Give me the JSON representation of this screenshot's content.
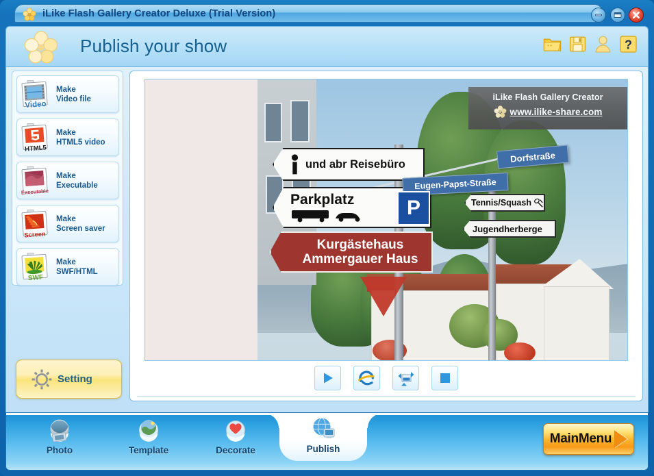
{
  "window": {
    "title": "iLike Flash Gallery Creator Deluxe (Trial Version)",
    "logo_icon": "clover-flower-icon",
    "controls": {
      "minimize": "minimize-button",
      "maximize": "maximize-button",
      "close": "close-button"
    }
  },
  "header": {
    "title": "Publish your show",
    "logo_icon": "clover-flower-icon",
    "icons": [
      {
        "name": "open-folder-icon",
        "glyph": "folder"
      },
      {
        "name": "save-icon",
        "glyph": "floppy"
      },
      {
        "name": "user-account-icon",
        "glyph": "person"
      },
      {
        "name": "help-icon",
        "glyph": "?"
      }
    ]
  },
  "sidebar": {
    "items": [
      {
        "icon": "video-file-icon",
        "badge": "Video",
        "line1": "Make",
        "line2": "Video file"
      },
      {
        "icon": "html5-video-icon",
        "badge": "HTML5",
        "line1": "Make",
        "line2": "HTML5 video"
      },
      {
        "icon": "executable-icon",
        "badge": "Executable",
        "line1": "Make",
        "line2": "Executable"
      },
      {
        "icon": "screen-saver-icon",
        "badge": "Screen",
        "line1": "Make",
        "line2": "Screen saver"
      },
      {
        "icon": "swf-html-icon",
        "badge": "SWF",
        "line1": "Make",
        "line2": "SWF/HTML"
      }
    ],
    "setting": {
      "label": "Setting",
      "icon": "gear-icon"
    }
  },
  "preview": {
    "watermark": {
      "line1": "iLike Flash Gallery Creator",
      "url": "www.ilike-share.com",
      "logo_icon": "clover-flower-icon"
    },
    "photo": {
      "description": "German street signpost with direction signs",
      "signs": [
        {
          "text": "und abr Reisebüro",
          "style": "white",
          "icon": "information-i-icon"
        },
        {
          "text": "Parkplatz",
          "style": "white",
          "plate": "P",
          "icon": "bus-and-car-icon"
        },
        {
          "text": "Kurgästehaus",
          "text2": "Ammergauer Haus",
          "style": "red"
        },
        {
          "text": "Dorfstraße",
          "style": "blue"
        },
        {
          "text": "Eugen-Papst-Straße",
          "style": "blue"
        },
        {
          "text": "Tennis/Squash",
          "style": "white-outline",
          "icon": "tennis-racket-icon"
        },
        {
          "text": "Jugendherberge",
          "style": "white-outline"
        }
      ]
    },
    "controls": [
      {
        "name": "play-button",
        "icon": "play-triangle-icon"
      },
      {
        "name": "open-in-browser-button",
        "icon": "internet-explorer-icon"
      },
      {
        "name": "fullscreen-button",
        "icon": "resize-arrows-icon"
      },
      {
        "name": "stop-button",
        "icon": "stop-square-icon"
      }
    ]
  },
  "bottom_nav": {
    "tabs": [
      {
        "label": "Photo",
        "icon": "photo-globe-icon",
        "active": false
      },
      {
        "label": "Template",
        "icon": "template-globe-icon",
        "active": false
      },
      {
        "label": "Decorate",
        "icon": "heart-globe-icon",
        "active": false
      },
      {
        "label": "Publish",
        "icon": "publish-globe-icon",
        "active": true
      }
    ],
    "main_menu": {
      "label": "MainMenu",
      "icon": "arrow-right-icon"
    }
  },
  "colors": {
    "accent_blue": "#1874b4",
    "title_text": "#13457e",
    "header_title": "#166190",
    "sidebar_label": "#17578f",
    "setting_yellow": "#fbe47c",
    "mainmenu_orange": "#fbb62f",
    "close_red": "#bf1a0c",
    "photo_bg": "#f0e8e6"
  }
}
